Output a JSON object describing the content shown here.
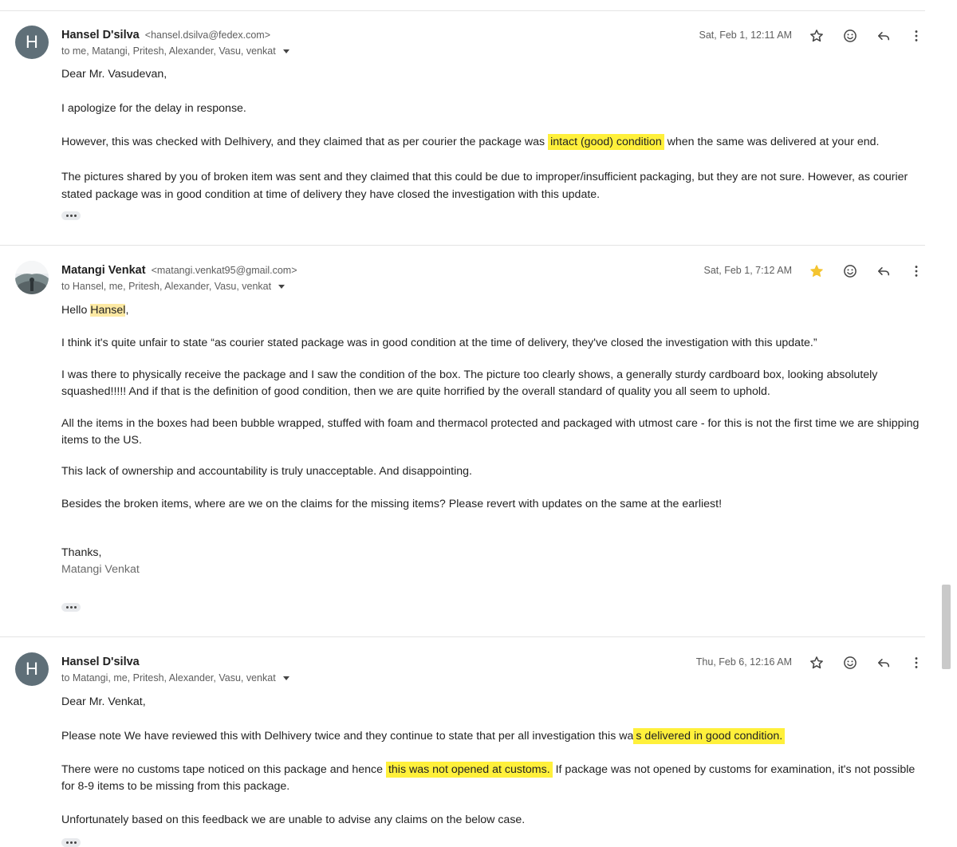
{
  "messages": [
    {
      "avatar_letter": "H",
      "sender": "Hansel D'silva",
      "email": "<hansel.dsilva@fedex.com>",
      "to": "to me, Matangi, Pritesh, Alexander, Vasu, venkat",
      "date": "Sat, Feb 1, 12:11 AM",
      "starred": false,
      "p1": "Dear Mr. Vasudevan,",
      "p2": "I apologize for the delay in response.",
      "p3a": "However, this was checked with Delhivery, and they claimed that as per courier the package was ",
      "p3hl": "intact (good) condition",
      "p3b": " when the same was delivered at your end.",
      "p4": "The pictures shared by you of broken item was sent and they claimed that this could be due to improper/insufficient packaging, but they are not sure. However, as courier stated package was in good condition at time of delivery they have closed the investigation with this update."
    },
    {
      "sender": "Matangi Venkat",
      "email": "<matangi.venkat95@gmail.com>",
      "to": "to Hansel, me, Pritesh, Alexander, Vasu, venkat",
      "date": "Sat, Feb 1, 7:12 AM",
      "starred": true,
      "greet_a": "Hello ",
      "greet_name": "Hansel",
      "greet_b": ",",
      "p2": "I think it's quite unfair to state “as courier stated package was in good condition at the time of delivery, they've closed the investigation with this update.”",
      "p3": "I was there to physically receive the package and I saw the condition of the box. The picture too clearly shows, a generally sturdy cardboard box, looking absolutely squashed!!!!! And if that is the definition of good condition, then we are quite horrified by the overall standard of quality you all seem to uphold.",
      "p4": "All the items in the boxes had been bubble wrapped, stuffed with foam and thermacol protected and packaged with utmost care - for this is not the first time we are shipping items to the US.",
      "p5": "This lack of ownership and accountability is truly unacceptable. And disappointing.",
      "p6": "Besides the broken items, where are we on the claims for the missing items? Please revert with updates on the same at the earliest!",
      "thanks": "Thanks,",
      "signature": "Matangi Venkat"
    },
    {
      "avatar_letter": "H",
      "sender": "Hansel D'silva",
      "to": "to Matangi, me, Pritesh, Alexander, Vasu, venkat",
      "date": "Thu, Feb 6, 12:16 AM",
      "starred": false,
      "p1": "Dear Mr. Venkat,",
      "p2a": "Please note We have reviewed this with Delhivery twice and they continue to state that per all investigation this wa",
      "p2hl": "s delivered in good condition.",
      "p3a": "There were no customs tape noticed on this package and hence ",
      "p3hl": "this was not opened at customs.",
      "p3b": " If package was not opened by customs for examination, it's not possible for 8-9 items to be missing from this package.",
      "p4": "Unfortunately based on this feedback we are unable to advise any claims on the below case."
    }
  ],
  "colors": {
    "highlight": "#fff03b",
    "name_highlight": "#fde9a3",
    "star_active": "#f4c430",
    "avatar_bg": "#5f6f78"
  },
  "icons": [
    "star-icon",
    "emoji-icon",
    "reply-icon",
    "more-vert-icon",
    "expand-caret-icon",
    "ellipsis-icon"
  ]
}
